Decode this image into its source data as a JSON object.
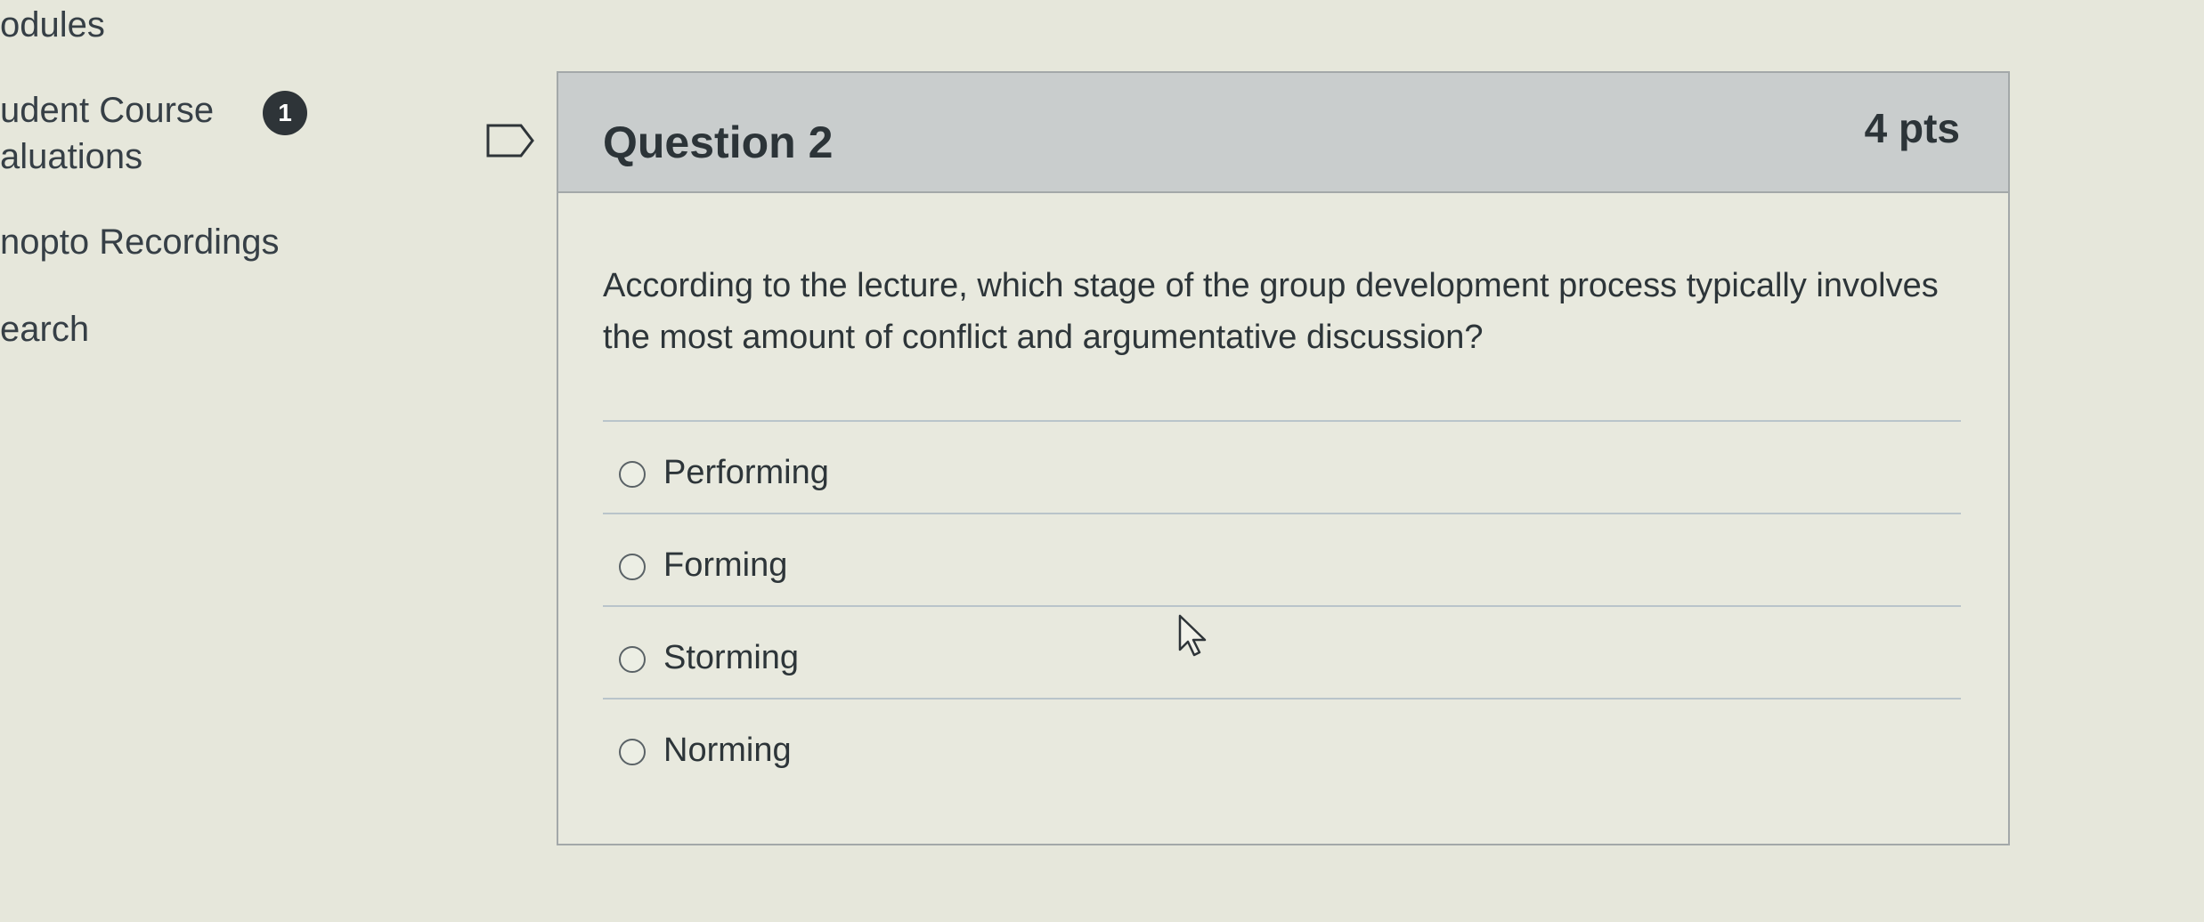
{
  "nav": {
    "modules": "odules",
    "course_evals_line1": "udent Course",
    "course_evals_line2": "aluations",
    "course_evals_badge": "1",
    "panopto": "nopto Recordings",
    "search": "earch"
  },
  "question": {
    "title": "Question 2",
    "points": "4 pts",
    "text": "According to the lecture, which stage of the group development process typically involves the most amount of conflict and argumentative discussion?",
    "flag_icon": "flag-icon",
    "answers": [
      {
        "label": "Performing",
        "selected": false
      },
      {
        "label": "Forming",
        "selected": false
      },
      {
        "label": "Storming",
        "selected": false
      },
      {
        "label": "Norming",
        "selected": false
      }
    ]
  },
  "colors": {
    "page_bg": "#e6e7db",
    "header_bg": "#c9cdcd",
    "card_border": "#a3a8a9",
    "text": "#2b3539",
    "badge_bg": "#2e3438"
  },
  "icons": {
    "flag": "flag-icon",
    "radio": "radio-icon",
    "cursor": "mouse-cursor-icon"
  }
}
